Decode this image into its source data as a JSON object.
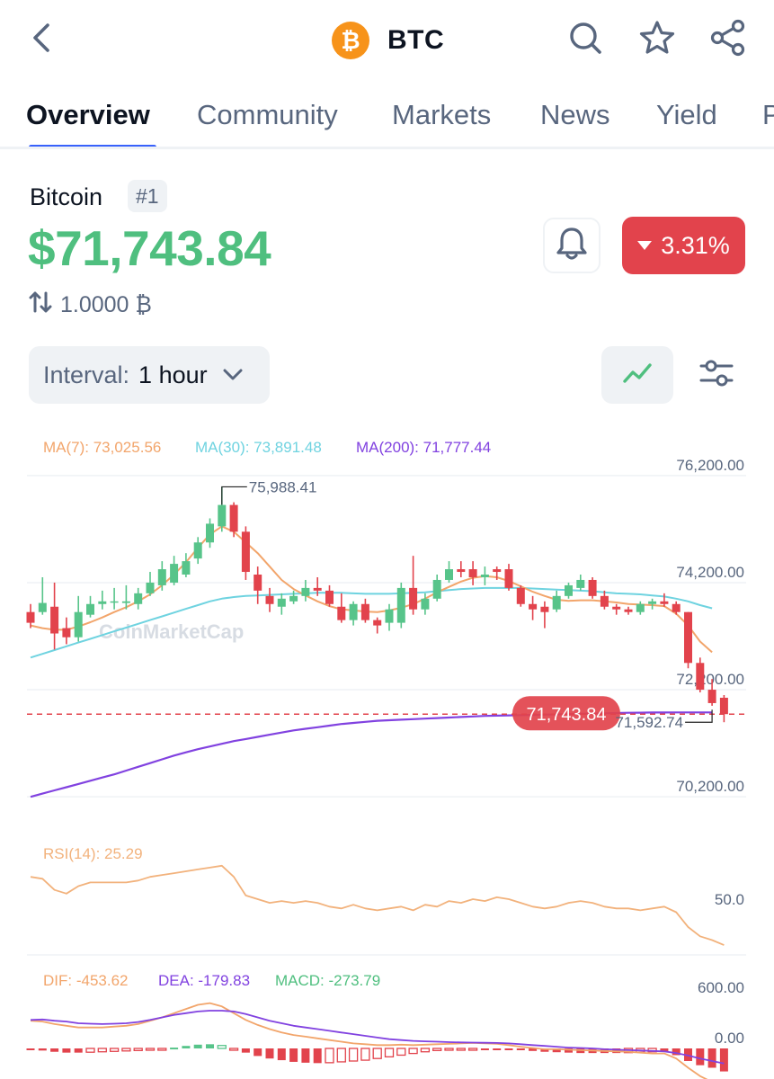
{
  "header": {
    "back_icon": "chevron-left-icon",
    "coin_symbol": "BTC",
    "coin_logo_glyph": "₿",
    "coin_logo_color": "#f7931a",
    "icons": [
      "search-icon",
      "star-icon",
      "share-icon"
    ]
  },
  "tabs": [
    {
      "label": "Overview",
      "active": true
    },
    {
      "label": "Community",
      "active": false
    },
    {
      "label": "Markets",
      "active": false
    },
    {
      "label": "News",
      "active": false
    },
    {
      "label": "Yield",
      "active": false
    },
    {
      "label": "P",
      "active": false
    }
  ],
  "coin": {
    "name": "Bitcoin",
    "rank": "#1",
    "price": "$71,743.84",
    "price_color": "#4fbf7f",
    "change": "3.31%",
    "change_direction": "down",
    "change_color": "#e2434c",
    "conversion": "1.0000 ₿"
  },
  "interval": {
    "label": "Interval:",
    "value": "1 hour"
  },
  "colors": {
    "up": "#57c48a",
    "down": "#e2434c",
    "ma7": "#f2a56b",
    "ma30": "#6fd3e0",
    "ma200": "#8142e0",
    "rsi": "#f2b27c",
    "dif": "#f2a56b",
    "dea": "#8142e0",
    "macd_label": "#4fbf7f",
    "axis_text": "#58667e",
    "grid": "#eff2f5"
  },
  "chart_data": [
    {
      "type": "candlestick",
      "ylim": [
        69800,
        76600
      ],
      "y_ticks": [
        {
          "value": 76200,
          "label": "76,200.00"
        },
        {
          "value": 74200,
          "label": "74,200.00"
        },
        {
          "value": 72200,
          "label": "72,200.00"
        },
        {
          "value": 70200,
          "label": "70,200.00"
        }
      ],
      "legend": [
        {
          "text": "MA(7): 73,025.56",
          "color": "#f2a56b"
        },
        {
          "text": "MA(30): 73,891.48",
          "color": "#6fd3e0"
        },
        {
          "text": "MA(200): 71,777.44",
          "color": "#8142e0"
        }
      ],
      "high_annotation": {
        "value": 75988.41,
        "label": "75,988.41",
        "index": 16
      },
      "low_annotation": {
        "value": 71592.74,
        "label": "71,592.74",
        "index": 50
      },
      "current_price": {
        "value": 71743.84,
        "label": "71,743.84"
      },
      "watermark": "CoinMarketCap",
      "candles": [
        {
          "o": 73650,
          "h": 73800,
          "l": 73350,
          "c": 73450
        },
        {
          "o": 73650,
          "h": 74300,
          "l": 73600,
          "c": 73820
        },
        {
          "o": 73750,
          "h": 74200,
          "l": 72950,
          "c": 73250
        },
        {
          "o": 73350,
          "h": 73550,
          "l": 73050,
          "c": 73180
        },
        {
          "o": 73180,
          "h": 73950,
          "l": 73100,
          "c": 73650
        },
        {
          "o": 73600,
          "h": 73950,
          "l": 73550,
          "c": 73800
        },
        {
          "o": 73800,
          "h": 74050,
          "l": 73700,
          "c": 73850
        },
        {
          "o": 73850,
          "h": 74100,
          "l": 73700,
          "c": 73850
        },
        {
          "o": 73820,
          "h": 74150,
          "l": 73700,
          "c": 73850
        },
        {
          "o": 73800,
          "h": 74100,
          "l": 73700,
          "c": 74000
        },
        {
          "o": 74000,
          "h": 74400,
          "l": 73950,
          "c": 74200
        },
        {
          "o": 74150,
          "h": 74600,
          "l": 74050,
          "c": 74450
        },
        {
          "o": 74200,
          "h": 74700,
          "l": 74150,
          "c": 74550
        },
        {
          "o": 74350,
          "h": 74750,
          "l": 74300,
          "c": 74600
        },
        {
          "o": 74650,
          "h": 75050,
          "l": 74550,
          "c": 74950
        },
        {
          "o": 74950,
          "h": 75400,
          "l": 74850,
          "c": 75300
        },
        {
          "o": 75250,
          "h": 75988,
          "l": 75150,
          "c": 75650
        },
        {
          "o": 75650,
          "h": 75700,
          "l": 75050,
          "c": 75150
        },
        {
          "o": 75150,
          "h": 75250,
          "l": 74250,
          "c": 74400
        },
        {
          "o": 74350,
          "h": 74500,
          "l": 73800,
          "c": 74050
        },
        {
          "o": 73950,
          "h": 74100,
          "l": 73650,
          "c": 73800
        },
        {
          "o": 73750,
          "h": 74000,
          "l": 73600,
          "c": 73900
        },
        {
          "o": 73850,
          "h": 74050,
          "l": 73800,
          "c": 73950
        },
        {
          "o": 73950,
          "h": 74250,
          "l": 73850,
          "c": 74100
        },
        {
          "o": 74100,
          "h": 74300,
          "l": 73950,
          "c": 74050
        },
        {
          "o": 74050,
          "h": 74150,
          "l": 73750,
          "c": 73800
        },
        {
          "o": 73750,
          "h": 74000,
          "l": 73450,
          "c": 73500
        },
        {
          "o": 73500,
          "h": 73850,
          "l": 73400,
          "c": 73800
        },
        {
          "o": 73800,
          "h": 73900,
          "l": 73450,
          "c": 73500
        },
        {
          "o": 73500,
          "h": 73550,
          "l": 73250,
          "c": 73400
        },
        {
          "o": 73450,
          "h": 73800,
          "l": 73300,
          "c": 73700
        },
        {
          "o": 73450,
          "h": 74200,
          "l": 73350,
          "c": 74100
        },
        {
          "o": 74100,
          "h": 74700,
          "l": 73600,
          "c": 73700
        },
        {
          "o": 73700,
          "h": 74000,
          "l": 73600,
          "c": 73900
        },
        {
          "o": 73900,
          "h": 74350,
          "l": 73850,
          "c": 74250
        },
        {
          "o": 74250,
          "h": 74600,
          "l": 74200,
          "c": 74450
        },
        {
          "o": 74450,
          "h": 74600,
          "l": 74300,
          "c": 74400
        },
        {
          "o": 74450,
          "h": 74600,
          "l": 74150,
          "c": 74300
        },
        {
          "o": 74300,
          "h": 74500,
          "l": 74150,
          "c": 74350
        },
        {
          "o": 74450,
          "h": 74500,
          "l": 74250,
          "c": 74400
        },
        {
          "o": 74450,
          "h": 74550,
          "l": 74050,
          "c": 74100
        },
        {
          "o": 74100,
          "h": 74150,
          "l": 73750,
          "c": 73800
        },
        {
          "o": 73800,
          "h": 73950,
          "l": 73500,
          "c": 73700
        },
        {
          "o": 73750,
          "h": 73850,
          "l": 73350,
          "c": 73650
        },
        {
          "o": 73700,
          "h": 74050,
          "l": 73650,
          "c": 73950
        },
        {
          "o": 73950,
          "h": 74200,
          "l": 73900,
          "c": 74150
        },
        {
          "o": 74100,
          "h": 74350,
          "l": 74050,
          "c": 74250
        },
        {
          "o": 74250,
          "h": 74300,
          "l": 73900,
          "c": 73950
        },
        {
          "o": 73950,
          "h": 74050,
          "l": 73700,
          "c": 73750
        },
        {
          "o": 73750,
          "h": 73800,
          "l": 73600,
          "c": 73700
        },
        {
          "o": 73700,
          "h": 73750,
          "l": 73600,
          "c": 73650
        },
        {
          "o": 73650,
          "h": 73850,
          "l": 73600,
          "c": 73800
        },
        {
          "o": 73800,
          "h": 73900,
          "l": 73700,
          "c": 73850
        },
        {
          "o": 73850,
          "h": 74000,
          "l": 73750,
          "c": 73800
        },
        {
          "o": 73800,
          "h": 73850,
          "l": 73600,
          "c": 73650
        },
        {
          "o": 73650,
          "h": 73650,
          "l": 72600,
          "c": 72700
        },
        {
          "o": 72700,
          "h": 72800,
          "l": 72150,
          "c": 72200
        },
        {
          "o": 72200,
          "h": 72400,
          "l": 71900,
          "c": 71950
        },
        {
          "o": 72050,
          "h": 72100,
          "l": 71593,
          "c": 71744
        }
      ],
      "ma7": [
        73400,
        73350,
        73320,
        73320,
        73380,
        73460,
        73550,
        73650,
        73740,
        73850,
        73980,
        74150,
        74350,
        74580,
        74850,
        75100,
        75250,
        75150,
        74950,
        74750,
        74500,
        74250,
        74080,
        73960,
        73850,
        73760,
        73700,
        73680,
        73660,
        73650,
        73680,
        73730,
        73800,
        73900,
        74020,
        74120,
        74220,
        74290,
        74320,
        74300,
        74230,
        74130,
        74030,
        73950,
        73880,
        73860,
        73870,
        73870,
        73850,
        73830,
        73800,
        73790,
        73780,
        73760,
        73620,
        73400,
        73100,
        72900
      ],
      "ma30": [
        72800,
        72870,
        72940,
        73010,
        73080,
        73150,
        73220,
        73290,
        73360,
        73430,
        73500,
        73570,
        73640,
        73710,
        73780,
        73850,
        73900,
        73930,
        73950,
        73960,
        73970,
        73980,
        73990,
        74000,
        74010,
        74010,
        74010,
        74000,
        73990,
        73990,
        73990,
        74000,
        74010,
        74020,
        74040,
        74060,
        74080,
        74090,
        74100,
        74100,
        74100,
        74100,
        74090,
        74080,
        74070,
        74060,
        74050,
        74040,
        74020,
        74000,
        73990,
        73980,
        73960,
        73940,
        73900,
        73850,
        73780,
        73720
      ],
      "ma200": [
        70200,
        70260,
        70320,
        70380,
        70440,
        70500,
        70560,
        70620,
        70690,
        70760,
        70830,
        70900,
        70970,
        71030,
        71090,
        71140,
        71190,
        71240,
        71280,
        71320,
        71360,
        71400,
        71440,
        71470,
        71500,
        71530,
        71560,
        71580,
        71600,
        71620,
        71630,
        71640,
        71650,
        71660,
        71670,
        71680,
        71690,
        71700,
        71710,
        71715,
        71720,
        71725,
        71730,
        71735,
        71740,
        71745,
        71750,
        71755,
        71760,
        71765,
        71770,
        71772,
        71774,
        71775,
        71776,
        71776,
        71777,
        71777
      ]
    },
    {
      "type": "line",
      "title": "RSI(14): 25.29",
      "ylim": [
        20,
        80
      ],
      "y_ticks": [
        {
          "value": 50,
          "label": "50.0"
        }
      ],
      "series": [
        {
          "name": "RSI(14)",
          "values": [
            62,
            61,
            55,
            53,
            57,
            59,
            59,
            59,
            59,
            60,
            62,
            63,
            64,
            65,
            66,
            67,
            68,
            62,
            52,
            50,
            48,
            49,
            48,
            49,
            48,
            46,
            45,
            47,
            45,
            44,
            45,
            46,
            44,
            47,
            46,
            49,
            48,
            50,
            49,
            51,
            50,
            48,
            46,
            45,
            46,
            48,
            49,
            48,
            46,
            45,
            45,
            44,
            45,
            46,
            43,
            35,
            30,
            28,
            25.29
          ]
        }
      ]
    },
    {
      "type": "bar",
      "title_items": [
        {
          "text": "DIF: -453.62",
          "color": "#f2a56b"
        },
        {
          "text": "DEA: -179.83",
          "color": "#8142e0"
        },
        {
          "text": "MACD: -273.79",
          "color": "#4fbf7f"
        }
      ],
      "ylim": [
        -800,
        700
      ],
      "y_ticks": [
        {
          "value": 600,
          "label": "600.00"
        },
        {
          "value": 0,
          "label": "0.00"
        }
      ],
      "macd": [
        -20,
        -25,
        -40,
        -50,
        -50,
        -45,
        -40,
        -35,
        -30,
        -25,
        -20,
        -10,
        10,
        30,
        45,
        50,
        35,
        -10,
        -50,
        -90,
        -120,
        -140,
        -160,
        -170,
        -175,
        -170,
        -160,
        -150,
        -140,
        -120,
        -100,
        -80,
        -60,
        -40,
        -25,
        -15,
        -10,
        -5,
        -5,
        -5,
        -10,
        -20,
        -30,
        -40,
        -45,
        -50,
        -55,
        -55,
        -55,
        -55,
        -50,
        -45,
        -40,
        -40,
        -80,
        -150,
        -200,
        -230,
        -274
      ],
      "dif": [
        330,
        320,
        290,
        270,
        250,
        250,
        250,
        260,
        270,
        290,
        330,
        370,
        420,
        470,
        520,
        540,
        500,
        420,
        340,
        280,
        230,
        190,
        160,
        140,
        120,
        100,
        80,
        60,
        50,
        40,
        40,
        45,
        40,
        45,
        50,
        55,
        60,
        65,
        60,
        55,
        40,
        20,
        5,
        -10,
        -10,
        -15,
        -20,
        -25,
        -30,
        -35,
        -40,
        -50,
        -60,
        -60,
        -120,
        -230,
        -330,
        -400,
        -454
      ],
      "dea": [
        340,
        345,
        330,
        320,
        300,
        295,
        290,
        295,
        300,
        315,
        340,
        370,
        400,
        420,
        440,
        450,
        450,
        440,
        410,
        370,
        330,
        300,
        270,
        250,
        230,
        210,
        190,
        170,
        150,
        130,
        110,
        100,
        90,
        85,
        80,
        75,
        72,
        70,
        68,
        65,
        60,
        50,
        40,
        30,
        20,
        10,
        5,
        0,
        -10,
        -15,
        -20,
        -25,
        -30,
        -35,
        -55,
        -85,
        -120,
        -150,
        -180
      ]
    }
  ]
}
